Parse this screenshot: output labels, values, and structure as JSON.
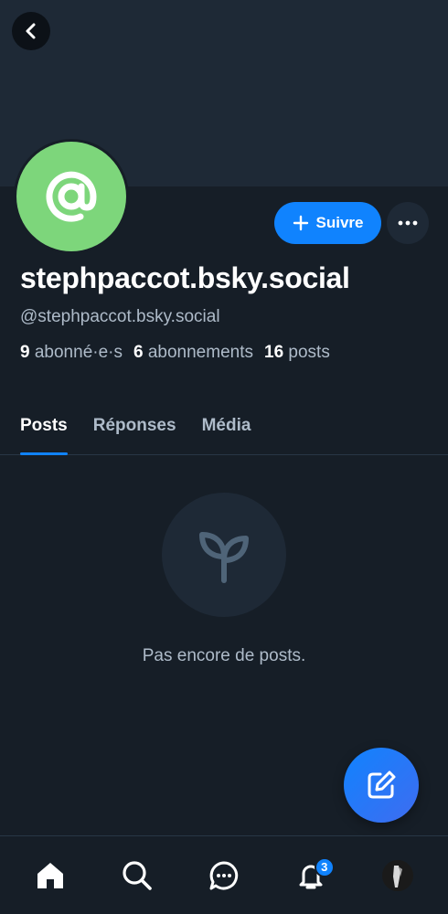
{
  "profile": {
    "display_name": "stephpaccot.bsky.social",
    "handle": "@stephpaccot.bsky.social",
    "avatar_icon": "at-sign-icon",
    "avatar_color": "#7dd67b",
    "follow_label": "Suivre",
    "stats": {
      "followers_count": "9",
      "followers_label": "abonné·e·s",
      "following_count": "6",
      "following_label": "abonnements",
      "posts_count": "16",
      "posts_label": "posts"
    }
  },
  "tabs": [
    {
      "label": "Posts",
      "active": true
    },
    {
      "label": "Réponses",
      "active": false
    },
    {
      "label": "Média",
      "active": false
    }
  ],
  "empty_state": {
    "icon": "sprout-icon",
    "text": "Pas encore de posts."
  },
  "compose": {
    "icon": "compose-icon"
  },
  "bottom_nav": {
    "items": [
      "home-icon",
      "search-icon",
      "chat-icon",
      "bell-icon",
      "user-avatar"
    ],
    "notification_count": "3"
  },
  "colors": {
    "accent": "#1083fe",
    "background": "#161e27",
    "secondary_text": "#aebbc9"
  }
}
